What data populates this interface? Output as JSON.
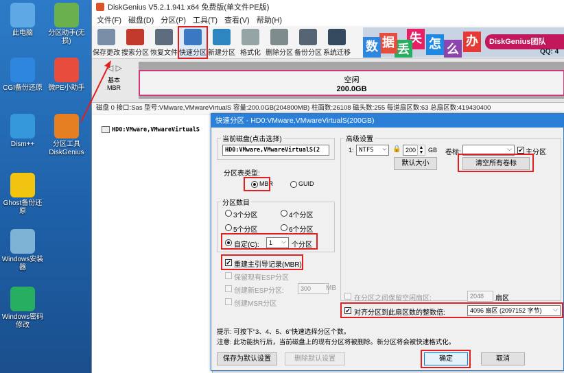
{
  "desktop": {
    "icons": [
      {
        "label": "此电脑",
        "color": "#5fa8e6"
      },
      {
        "label": "分区助手(无损)",
        "color": "#6ab04c"
      },
      {
        "label": "CGI备份还原",
        "color": "#2e86de"
      },
      {
        "label": "微PE小助手",
        "color": "#e74c3c"
      },
      {
        "label": "Dism++",
        "color": "#3498db"
      },
      {
        "label": "分区工具DiskGenius",
        "color": "#e67e22"
      },
      {
        "label": "Ghost备份还原",
        "color": "#f1c40f"
      },
      {
        "label": "Windows安装器",
        "color": "#7fb3d5"
      },
      {
        "label": "Windows密码修改",
        "color": "#27ae60"
      }
    ]
  },
  "app": {
    "title": "DiskGenius V5.2.1.941 x64 免费版(单文件PE版)",
    "menu": [
      "文件(F)",
      "磁盘(D)",
      "分区(P)",
      "工具(T)",
      "查看(V)",
      "帮助(H)"
    ],
    "toolbar": [
      {
        "label": "保存更改",
        "icon": "save-icon",
        "color": "#7a8ea8"
      },
      {
        "label": "搜索分区",
        "icon": "search-icon",
        "color": "#c0392b"
      },
      {
        "label": "恢复文件",
        "icon": "restore-icon",
        "color": "#5d6d7e"
      },
      {
        "label": "快速分区",
        "icon": "quick-partition-icon",
        "color": "#3a78c2",
        "selected": true
      },
      {
        "label": "新建分区",
        "icon": "new-partition-icon",
        "color": "#2e86c1"
      },
      {
        "label": "格式化",
        "icon": "format-icon",
        "color": "#95a5a6"
      },
      {
        "label": "删除分区",
        "icon": "delete-icon",
        "color": "#7f8c8d"
      },
      {
        "label": "备份分区",
        "icon": "backup-icon",
        "color": "#566573"
      },
      {
        "label": "系统迁移",
        "icon": "migrate-icon",
        "color": "#34495e"
      }
    ],
    "banner": {
      "chars": [
        {
          "ch": "数",
          "color": "#2e86de"
        },
        {
          "ch": "据",
          "color": "#e74c3c"
        },
        {
          "ch": "丢",
          "color": "#27ae60"
        },
        {
          "ch": "失",
          "color": "#e91e63"
        },
        {
          "ch": "怎",
          "color": "#1e88e5"
        },
        {
          "ch": "么",
          "color": "#8e44ad"
        },
        {
          "ch": "办",
          "color": "#e53935"
        }
      ],
      "brand": "DiskGenius团队",
      "qq": "QQ: 4"
    },
    "diskmap": {
      "nav": "◁ ▷",
      "basic": "基本",
      "mbr": "MBR",
      "free_label": "空闲",
      "free_size": "200.0GB"
    },
    "diskinfo": "磁盘 0 接口:Sas 型号:VMware,VMwareVirtualS 容量:200.0GB(204800MB) 柱面数:26108 磁头数:255 每道扇区数:63 总扇区数:419430400",
    "tree": {
      "node": "HD0:VMware,VMwareVirtualS"
    }
  },
  "dialog": {
    "title": "快速分区 - HD0:VMware,VMwareVirtualS(200GB)",
    "current_disk_label": "当前磁盘(点击选择)",
    "current_disk_value": "HD0:VMware,VMwareVirtualS(2",
    "partition_table_label": "分区表类型:",
    "mbr": "MBR",
    "guid": "GUID",
    "partition_count_label": "分区数目",
    "opt3": "3个分区",
    "opt4": "4个分区",
    "opt5": "5个分区",
    "opt6": "6个分区",
    "custom_label": "自定(C):",
    "custom_value": "1",
    "custom_unit": "个分区",
    "rebuild_mbr": "重建主引导记录(MBR)",
    "keep_esp": "保留现有ESP分区",
    "create_esp": "创建新ESP分区:",
    "esp_size": "300",
    "esp_unit": "MB",
    "create_msr": "创建MSR分区",
    "advanced_label": "高级设置",
    "row_index": "1:",
    "fs": "NTFS",
    "size": "200",
    "size_unit": "GB",
    "volume_label": "卷标:",
    "volume_value": "",
    "primary": "主分区",
    "default_size_btn": "默认大小",
    "clear_labels_btn": "清空所有卷标",
    "keep_free_label": "在分区之间保留空闲扇区:",
    "keep_free_value": "2048",
    "sector_unit": "扇区",
    "align_label": "对齐分区到此扇区数的整数倍:",
    "align_value": "4096 扇区 (2097152 字节)",
    "hint": "提示: 可按下“3、4、5、6”快速选择分区个数。",
    "note": "注意: 此功能执行后，当前磁盘上的现有分区将被删除。新分区将会被快速格式化。",
    "save_default_btn": "保存为默认设置",
    "delete_default_btn": "删除默认设置",
    "ok_btn": "确定",
    "cancel_btn": "取消"
  }
}
